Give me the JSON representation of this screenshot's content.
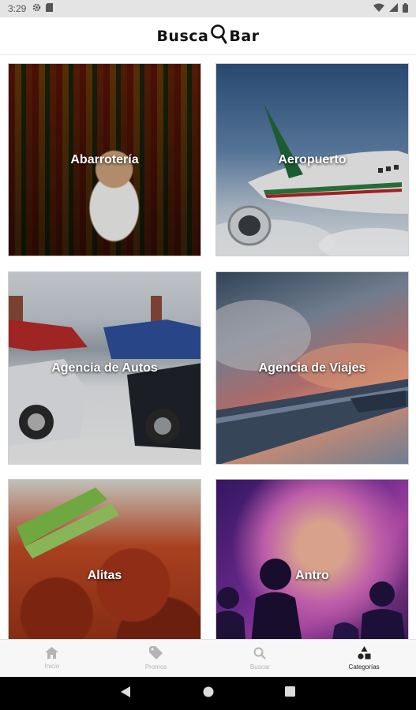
{
  "status_bar": {
    "time": "3:29",
    "icons": [
      "gear-icon",
      "sd-card-icon",
      "wifi-icon",
      "signal-icon",
      "battery-icon"
    ]
  },
  "app": {
    "logo_left": "Busca",
    "logo_right": "Bar"
  },
  "categories": [
    {
      "label": "Abarrotería"
    },
    {
      "label": "Aeropuerto"
    },
    {
      "label": "Agencia de Autos"
    },
    {
      "label": "Agencia de Viajes"
    },
    {
      "label": "Alitas"
    },
    {
      "label": "Antro"
    }
  ],
  "bottom_nav": [
    {
      "label": "Inicio",
      "icon": "home-icon",
      "active": false
    },
    {
      "label": "Promos",
      "icon": "tag-icon",
      "active": false
    },
    {
      "label": "Buscar",
      "icon": "search-icon",
      "active": false
    },
    {
      "label": "Categorías",
      "icon": "categories-icon",
      "active": true
    }
  ],
  "colors": {
    "nav_inactive": "#b5b5b5",
    "nav_active": "#222222",
    "system_nav": "#000000"
  }
}
